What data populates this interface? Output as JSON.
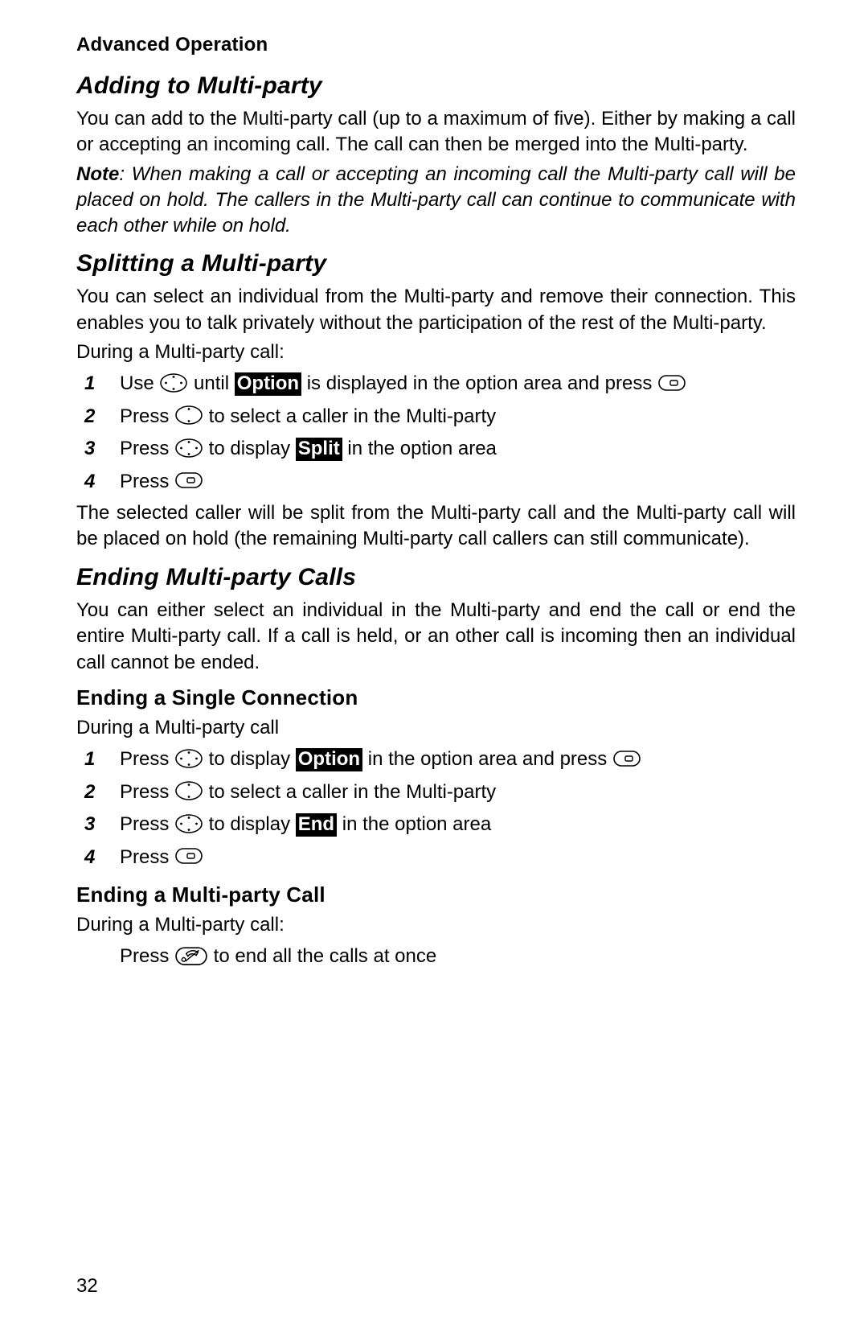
{
  "header": "Advanced Operation",
  "page_number": "32",
  "sections": {
    "adding": {
      "title": "Adding to Multi-party",
      "para": "You can add to the Multi-party call (up to a maximum of five). Either by making a call or accepting an incoming call. The call can then be merged into the Multi-party.",
      "note_label": "Note",
      "note_text": ": When making a call or accepting an incoming call the Multi-party call will be placed on hold. The callers in the Multi-party call can continue to communicate with each other while on hold."
    },
    "splitting": {
      "title": "Splitting a Multi-party",
      "para": "You can select an individual from the Multi-party and remove their connection. This enables you to talk privately without the participation of the rest of the Multi-party.",
      "intro": "During a Multi-party call:",
      "steps": {
        "s1a": "Use ",
        "s1b": " until ",
        "s1_opt": "Option",
        "s1c": " is displayed in the option area and press ",
        "s2a": "Press ",
        "s2b": " to select a caller in the Multi-party",
        "s3a": "Press ",
        "s3b": " to display ",
        "s3_opt": "Split",
        "s3c": " in the option area",
        "s4a": "Press "
      },
      "result": "The selected caller will be split from the Multi-party call and the Multi-party call will be placed on hold (the remaining Multi-party call callers can still communicate)."
    },
    "ending": {
      "title": "Ending Multi-party Calls",
      "para": "You can either select an individual in the Multi-party and end the call or end the entire Multi-party call. If a call is held, or an other call is incoming then an individual call cannot be ended.",
      "single": {
        "title": "Ending a Single Connection",
        "intro": "During a Multi-party call",
        "steps": {
          "s1a": "Press ",
          "s1b": " to display ",
          "s1_opt": "Option",
          "s1c": " in the option area and press ",
          "s2a": "Press ",
          "s2b": " to select a caller in the Multi-party",
          "s3a": "Press ",
          "s3b": " to display ",
          "s3_opt": "End",
          "s3c": " in the option area",
          "s4a": "Press "
        }
      },
      "all": {
        "title": "Ending a Multi-party Call",
        "intro": "During a Multi-party call:",
        "step": {
          "a": "Press ",
          "b": " to end all the calls at once"
        }
      }
    }
  }
}
